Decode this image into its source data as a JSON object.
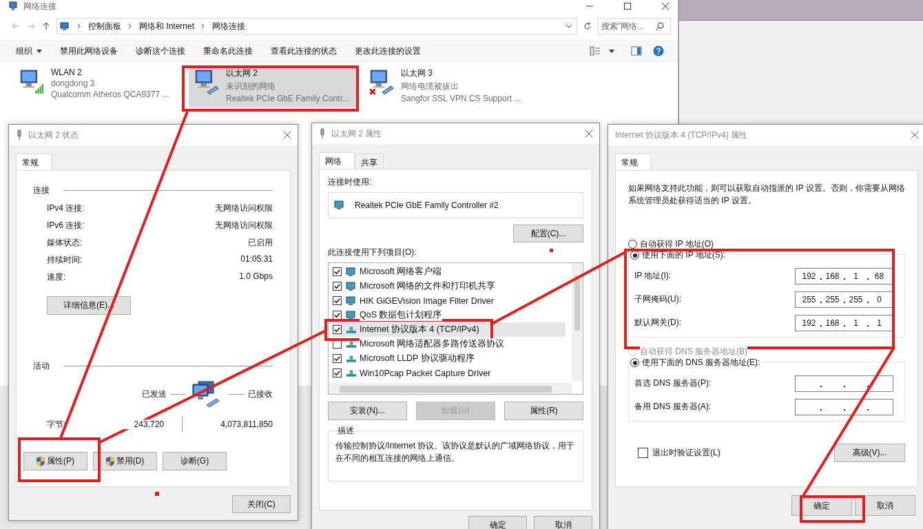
{
  "explorer": {
    "title": "网络连接",
    "breadcrumb": [
      "控制面板",
      "网络和 Internet",
      "网络连接"
    ],
    "search": {
      "placeholder": "搜索\"网络..."
    },
    "organize": "组织",
    "commands": [
      "禁用此网络设备",
      "诊断这个连接",
      "重命名此连接",
      "查看此连接的状态",
      "更改此连接的设置"
    ],
    "connections": [
      {
        "name": "WLAN 2",
        "status": "dongdong 3",
        "adapter": "Qualcomm Atheros QCA9377 ...",
        "kind": "wifi",
        "selected": false
      },
      {
        "name": "以太网 2",
        "status": "未识别的网络",
        "adapter": "Realtek PCIe GbE Family Contr...",
        "kind": "ethernet",
        "selected": true
      },
      {
        "name": "以太网 3",
        "status": "网络电缆被拔出",
        "adapter": "Sangfor SSL VPN CS Support ...",
        "kind": "unplugged",
        "selected": false
      }
    ]
  },
  "status_dialog": {
    "title": "以太网 2 状态",
    "tab": "常规",
    "connection_heading": "连接",
    "rows": [
      {
        "label": "IPv4 连接:",
        "value": "无网络访问权限"
      },
      {
        "label": "IPv6 连接:",
        "value": "无网络访问权限"
      },
      {
        "label": "媒体状态:",
        "value": "已启用"
      },
      {
        "label": "持续时间:",
        "value": "01:05:31"
      },
      {
        "label": "速度:",
        "value": "1.0 Gbps"
      }
    ],
    "details_button": "详细信息(E)...",
    "activity_heading": "活动",
    "sent_label": "已发送",
    "received_label": "已接收",
    "bytes_label": "字节:",
    "bytes_sent": "243,720",
    "bytes_received": "4,073,811,850",
    "buttons": [
      {
        "label": "属性(P)",
        "shield": true
      },
      {
        "label": "禁用(D)",
        "shield": true
      },
      {
        "label": "诊断(G)",
        "shield": false
      }
    ],
    "close_button": "关闭(C)"
  },
  "props_dialog": {
    "title": "以太网 2 属性",
    "tabs": [
      {
        "label": "网络",
        "selected": true
      },
      {
        "label": "共享",
        "selected": false
      }
    ],
    "connect_using_label": "连接时使用:",
    "adapter": "Realtek PCIe GbE Family Controller #2",
    "configure_button": "配置(C)...",
    "items_label": "此连接使用下列项目(O):",
    "items": [
      {
        "label": "Microsoft 网络客户端",
        "checked": true,
        "kind": "client",
        "selected": false
      },
      {
        "label": "Microsoft 网络的文件和打印机共享",
        "checked": true,
        "kind": "client",
        "selected": false
      },
      {
        "label": "HIK GiGEVision Image Filter Driver",
        "checked": true,
        "kind": "client",
        "selected": false
      },
      {
        "label": "QoS 数据包计划程序",
        "checked": true,
        "kind": "client",
        "selected": false
      },
      {
        "label": "Internet 协议版本 4 (TCP/IPv4)",
        "checked": true,
        "kind": "protocol",
        "selected": true
      },
      {
        "label": "Microsoft 网络适配器多路传送器协议",
        "checked": false,
        "kind": "protocol",
        "selected": false
      },
      {
        "label": "Microsoft LLDP 协议驱动程序",
        "checked": true,
        "kind": "protocol",
        "selected": false
      },
      {
        "label": "Win10Pcap Packet Capture Driver",
        "checked": true,
        "kind": "protocol",
        "selected": false
      }
    ],
    "buttons": [
      {
        "label": "安装(N)...",
        "disabled": false
      },
      {
        "label": "卸载(U)",
        "disabled": true
      },
      {
        "label": "属性(R)",
        "disabled": false
      }
    ],
    "description_heading": "描述",
    "description": "传输控制协议/Internet 协议。该协议是默认的广域网络协议，用于在不同的相互连接的网络上通信。",
    "ok_button": "确定",
    "cancel_button": "取消"
  },
  "ipv4_dialog": {
    "title": "Internet 协议版本 4 (TCP/IPv4) 属性",
    "tab": "常规",
    "intro": "如果网络支持此功能，则可以获取自动指派的 IP 设置。否则，你需要从网络系统管理员处获得适当的 IP 设置。",
    "ip_options": [
      {
        "label": "自动获得 IP 地址(O)",
        "selected": false,
        "disabled": false
      },
      {
        "label": "使用下面的 IP 地址(S):",
        "selected": true,
        "disabled": false
      }
    ],
    "ip_fields": [
      {
        "label": "IP 地址(I):",
        "octets": [
          "192",
          "168",
          "1",
          "68"
        ]
      },
      {
        "label": "子网掩码(U):",
        "octets": [
          "255",
          "255",
          "255",
          "0"
        ]
      },
      {
        "label": "默认网关(D):",
        "octets": [
          "192",
          "168",
          "1",
          "1"
        ]
      }
    ],
    "dns_options": [
      {
        "label": "自动获得 DNS 服务器地址(B)",
        "selected": false,
        "disabled": true
      },
      {
        "label": "使用下面的 DNS 服务器地址(E):",
        "selected": true,
        "disabled": false
      }
    ],
    "dns_fields": [
      {
        "label": "首选 DNS 服务器(P):"
      },
      {
        "label": "备用 DNS 服务器(A):"
      }
    ],
    "validate_checkbox": {
      "label": "退出时验证设置(L)",
      "checked": false
    },
    "advanced_button": "高级(V)...",
    "ok_button": "确定",
    "cancel_button": "取消"
  }
}
